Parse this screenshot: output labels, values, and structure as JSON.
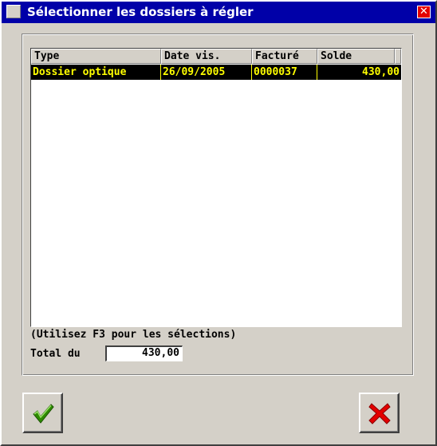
{
  "window": {
    "title": "Sélectionner les dossiers à régler",
    "close_icon": "close-icon"
  },
  "grid": {
    "columns": [
      "Type",
      "Date vis.",
      "Facturé",
      "Solde"
    ],
    "rows": [
      {
        "type": "Dossier optique",
        "date": "26/09/2005",
        "facture": "0000037",
        "solde": "430,00"
      }
    ],
    "selected_row": 0
  },
  "hint": "(Utilisez F3 pour les sélections)",
  "total": {
    "label": "Total du",
    "value": "430,00"
  },
  "buttons": {
    "ok_icon": "checkmark-icon",
    "cancel_icon": "cross-icon"
  },
  "colors": {
    "titlebar": "#0000a8",
    "selection_bg": "#000000",
    "selection_fg": "#ffff00",
    "ok_icon": "#2e8b00",
    "cancel_icon": "#e40000"
  }
}
